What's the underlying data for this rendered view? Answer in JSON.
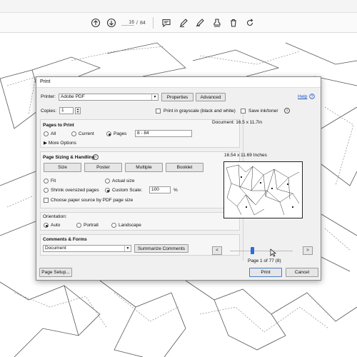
{
  "viewer": {
    "current_page": "16",
    "page_separator": "/",
    "total_pages": "84"
  },
  "dialog": {
    "title": "Print",
    "printer_label": "Printer:",
    "printer_value": "Adobe PDF",
    "properties_label": "Properties",
    "advanced_label": "Advanced",
    "help_label": "Help",
    "copies_label": "Copies:",
    "copies_value": "1",
    "grayscale_label": "Print in grayscale (black and white)",
    "save_ink_label": "Save ink/toner",
    "pages_to_print": {
      "heading": "Pages to Print",
      "all_label": "All",
      "current_label": "Current",
      "pages_label": "Pages",
      "pages_value": "8 - 84",
      "more_options_label": "More Options"
    },
    "sizing": {
      "heading": "Page Sizing & Handling",
      "size_label": "Size",
      "poster_label": "Poster",
      "multiple_label": "Multiple",
      "booklet_label": "Booklet",
      "fit_label": "Fit",
      "actual_size_label": "Actual size",
      "shrink_label": "Shrink oversized pages",
      "custom_scale_label": "Custom Scale:",
      "custom_scale_value": "100",
      "percent_label": "%",
      "choose_source_label": "Choose paper source by PDF page size"
    },
    "orientation": {
      "heading": "Orientation:",
      "auto_label": "Auto",
      "portrait_label": "Portrait",
      "landscape_label": "Landscape"
    },
    "comments": {
      "heading": "Comments & Forms",
      "value": "Document",
      "summarize_label": "Summarize Comments"
    },
    "preview": {
      "document_size": "Document: 16.5 x 11.7in",
      "paper_size": "16.54 x 11.69 Inches",
      "page_status": "Page 1 of 77 (8)",
      "prev_label": "<",
      "next_label": ">"
    },
    "page_setup_label": "Page Setup...",
    "print_label": "Print",
    "cancel_label": "Cancel"
  },
  "colors": {
    "accent": "#2a6fd6",
    "link": "#1a53c5"
  }
}
